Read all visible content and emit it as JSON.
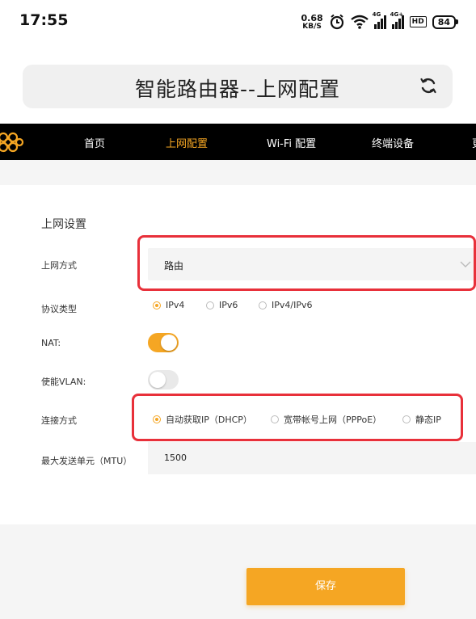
{
  "status_bar": {
    "time": "17:55",
    "net_speed_value": "0.68",
    "net_speed_unit": "KB/S",
    "sim1_label": "4G",
    "sim2_label": "4G+",
    "hd_label": "HD",
    "battery": "84"
  },
  "header": {
    "title": "智能路由器--上网配置"
  },
  "nav": {
    "items": [
      {
        "label": "首页",
        "active": false
      },
      {
        "label": "上网配置",
        "active": true
      },
      {
        "label": "Wi-Fi 配置",
        "active": false
      },
      {
        "label": "终端设备",
        "active": false
      },
      {
        "label": "更",
        "active": false
      }
    ],
    "accent_color": "#f5a623"
  },
  "form": {
    "section_title": "上网设置",
    "access_mode": {
      "label": "上网方式",
      "value": "路由"
    },
    "protocol": {
      "label": "协议类型",
      "options": [
        {
          "label": "IPv4",
          "selected": true
        },
        {
          "label": "IPv6",
          "selected": false
        },
        {
          "label": "IPv4/IPv6",
          "selected": false
        }
      ]
    },
    "nat": {
      "label": "NAT:",
      "enabled": true
    },
    "vlan": {
      "label": "使能VLAN:",
      "enabled": false
    },
    "connection": {
      "label": "连接方式",
      "options": [
        {
          "label": "自动获取IP（DHCP）",
          "selected": true
        },
        {
          "label": "宽带帐号上网（PPPoE）",
          "selected": false
        },
        {
          "label": "静态IP",
          "selected": false
        }
      ]
    },
    "mtu": {
      "label": "最大发送单元（MTU）",
      "value": "1500"
    }
  },
  "actions": {
    "save_label": "保存"
  },
  "colors": {
    "accent": "#f5a623",
    "highlight_box": "#e8303a",
    "nav_background": "#000000"
  }
}
